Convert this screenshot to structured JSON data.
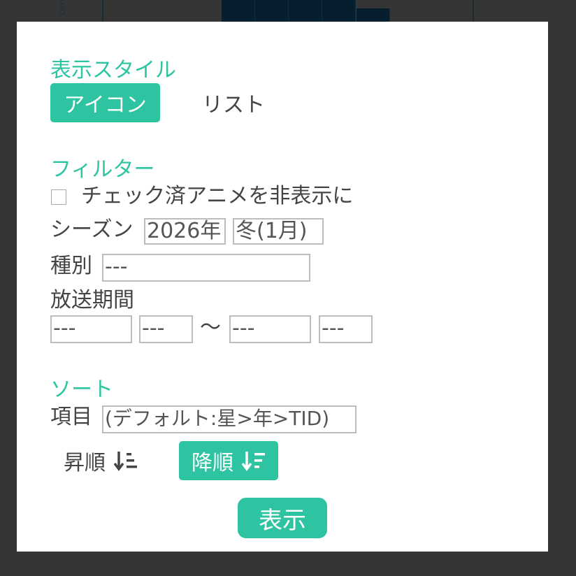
{
  "background": {
    "label": "cent"
  },
  "colors": {
    "accent": "#2ec4a2",
    "text": "#444444",
    "backdrop": "#353535"
  },
  "display_style": {
    "title": "表示スタイル",
    "icon_label": "アイコン",
    "list_label": "リスト",
    "selected": "アイコン"
  },
  "filter": {
    "title": "フィルター",
    "hide_checked_label": "チェック済アニメを非表示に",
    "hide_checked_value": false,
    "season_label": "シーズン",
    "season_year": "2026年",
    "season_quarter": "冬(1月)",
    "type_label": "種別",
    "type_value": "---",
    "period_label": "放送期間",
    "period_from_year": "---",
    "period_from_quarter": "---",
    "period_separator": "〜",
    "period_to_year": "---",
    "period_to_quarter": "---"
  },
  "sort": {
    "title": "ソート",
    "item_label": "項目",
    "item_value": "(デフォルト:星>年>TID)",
    "asc_label": "昇順",
    "desc_label": "降順",
    "asc_icon": "sort-ascending-icon",
    "desc_icon": "sort-descending-icon",
    "selected": "降順"
  },
  "actions": {
    "show_label": "表示"
  }
}
